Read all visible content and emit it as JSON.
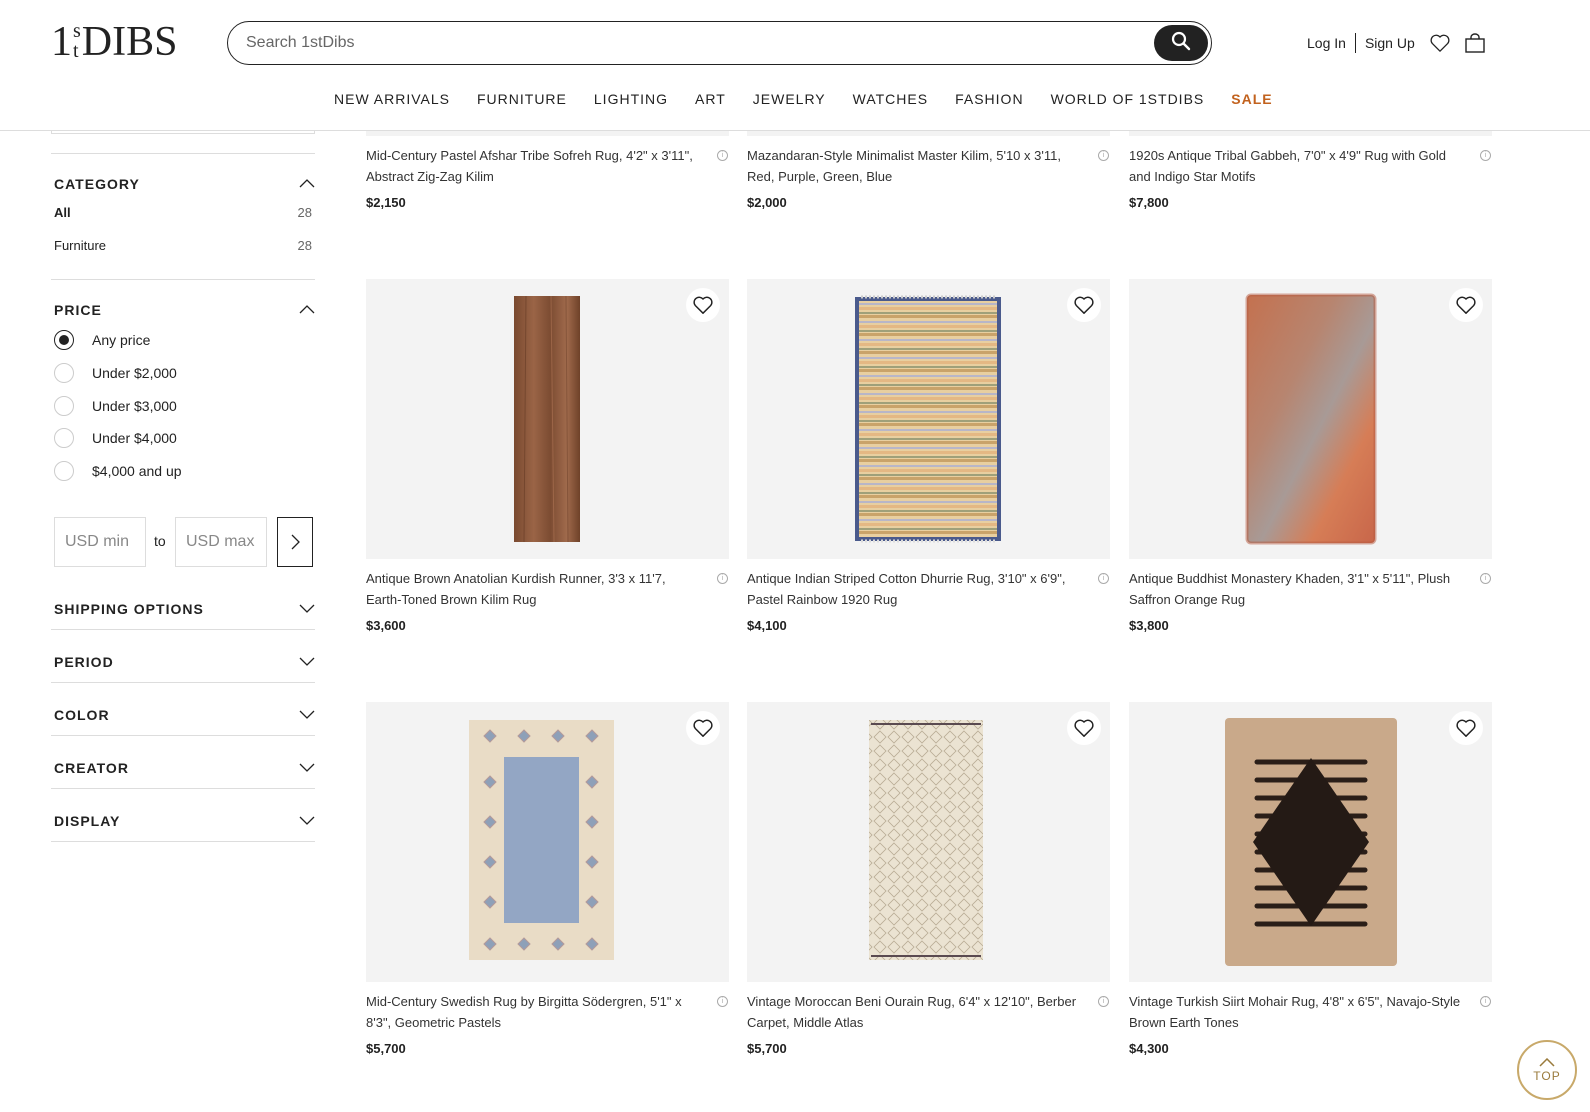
{
  "header": {
    "logo": "1stDIBS",
    "logo_parts": [
      "1",
      "s",
      "t",
      "DIBS"
    ],
    "search_placeholder": "Search 1stDibs",
    "login_label": "Log In",
    "signup_label": "Sign Up",
    "icons": [
      "search-icon",
      "heart-icon",
      "bag-icon"
    ]
  },
  "nav": {
    "items": [
      "NEW ARRIVALS",
      "FURNITURE",
      "LIGHTING",
      "ART",
      "JEWELRY",
      "WATCHES",
      "FASHION",
      "WORLD OF 1STDIBS"
    ],
    "sale_label": "SALE",
    "sale_color": "#c2621e"
  },
  "filters": {
    "category": {
      "title": "CATEGORY",
      "items": [
        {
          "label": "All",
          "count": "28"
        },
        {
          "label": "Furniture",
          "count": "28"
        }
      ]
    },
    "price": {
      "title": "PRICE",
      "options": [
        "Any price",
        "Under $2,000",
        "Under $3,000",
        "Under $4,000",
        "$4,000 and up"
      ],
      "selected": "Any price",
      "min_placeholder": "USD min",
      "max_placeholder": "USD max",
      "to_label": "to"
    },
    "collapsed_sections": [
      "SHIPPING OPTIONS",
      "PERIOD",
      "COLOR",
      "CREATOR",
      "DISPLAY"
    ]
  },
  "products": [
    {
      "title_line1": "Mid-Century Pastel Afshar Tribe Sofreh Rug, 4'2\" x 3'11\",",
      "title_line2": "Abstract Zig-Zag Kilim",
      "price": "$2,150"
    },
    {
      "title_line1": "Mazandaran-Style Minimalist Master Kilim, 5'10 x 3'11,",
      "title_line2": "Red, Purple, Green, Blue",
      "price": "$2,000"
    },
    {
      "title_line1": "1920s Antique Tribal Gabbeh, 7'0\" x 4'9\" Rug with Gold",
      "title_line2": "and Indigo Star Motifs",
      "price": "$7,800"
    },
    {
      "title_line1": "Antique Brown Anatolian Kurdish Runner, 3'3 x 11'7,",
      "title_line2": "Earth-Toned Brown Kilim Rug",
      "price": "$3,600"
    },
    {
      "title_line1": "Antique Indian Striped Cotton Dhurrie Rug, 3'10\" x 6'9\",",
      "title_line2": "Pastel Rainbow 1920 Rug",
      "price": "$4,100"
    },
    {
      "title_line1": "Antique Buddhist Monastery Khaden, 3'1\" x 5'11\", Plush",
      "title_line2": "Saffron Orange Rug",
      "price": "$3,800"
    },
    {
      "title_line1": "Mid-Century Swedish Rug by Birgitta Södergren, 5'1\" x",
      "title_line2": "8'3\", Geometric Pastels",
      "price": "$5,700"
    },
    {
      "title_line1": "Vintage Moroccan Beni Ourain Rug, 6'4\" x 12'10\", Berber",
      "title_line2": "Carpet, Middle Atlas",
      "price": "$5,700"
    },
    {
      "title_line1": "Vintage Turkish Siirt Mohair Rug, 4'8\" x 6'5\", Navajo-Style",
      "title_line2": "Brown Earth Tones",
      "price": "$4,300"
    }
  ],
  "top_button": {
    "label": "TOP",
    "color": "#c8a96a"
  }
}
